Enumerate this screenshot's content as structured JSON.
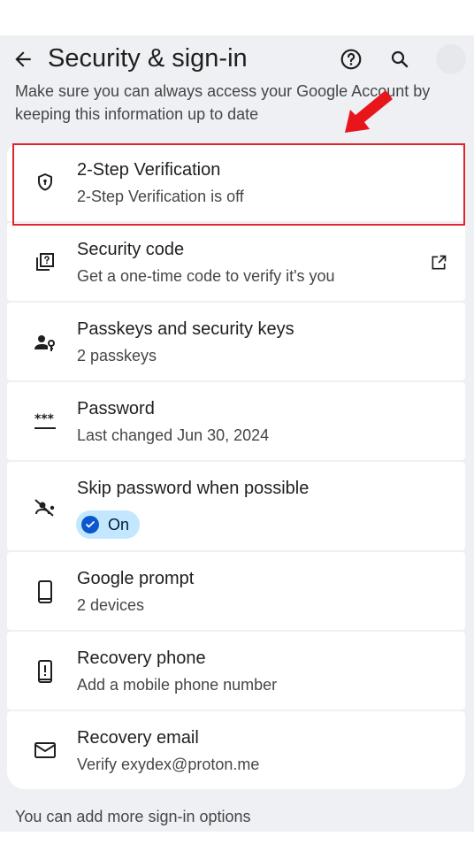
{
  "header": {
    "title": "Security & sign-in"
  },
  "intro_text": "Make sure you can always access your Google Account by keeping this information up to date",
  "items": [
    {
      "title": "2-Step Verification",
      "subtitle": "2-Step Verification is off",
      "icon": "shield-lock-icon"
    },
    {
      "title": "Security code",
      "subtitle": "Get a one-time code to verify it's you",
      "icon": "security-code-icon",
      "trailing_icon": "open-in-new-icon"
    },
    {
      "title": "Passkeys and security keys",
      "subtitle": "2 passkeys",
      "icon": "passkey-icon"
    },
    {
      "title": "Password",
      "subtitle": "Last changed Jun 30, 2024",
      "icon": "password-icon"
    },
    {
      "title": "Skip password when possible",
      "chip_label": "On",
      "icon": "skip-password-icon"
    },
    {
      "title": "Google prompt",
      "subtitle": "2 devices",
      "icon": "phone-icon"
    },
    {
      "title": "Recovery phone",
      "subtitle": "Add a mobile phone number",
      "icon": "phone-alert-icon"
    },
    {
      "title": "Recovery email",
      "subtitle": "Verify exydex@proton.me",
      "icon": "mail-icon"
    }
  ],
  "footer_text": "You can add more sign-in options",
  "colors": {
    "background": "#eef0f4",
    "card": "#ffffff",
    "chip_bg": "#c2e7ff",
    "chip_check": "#0b57d0",
    "highlight": "#e0242b"
  }
}
